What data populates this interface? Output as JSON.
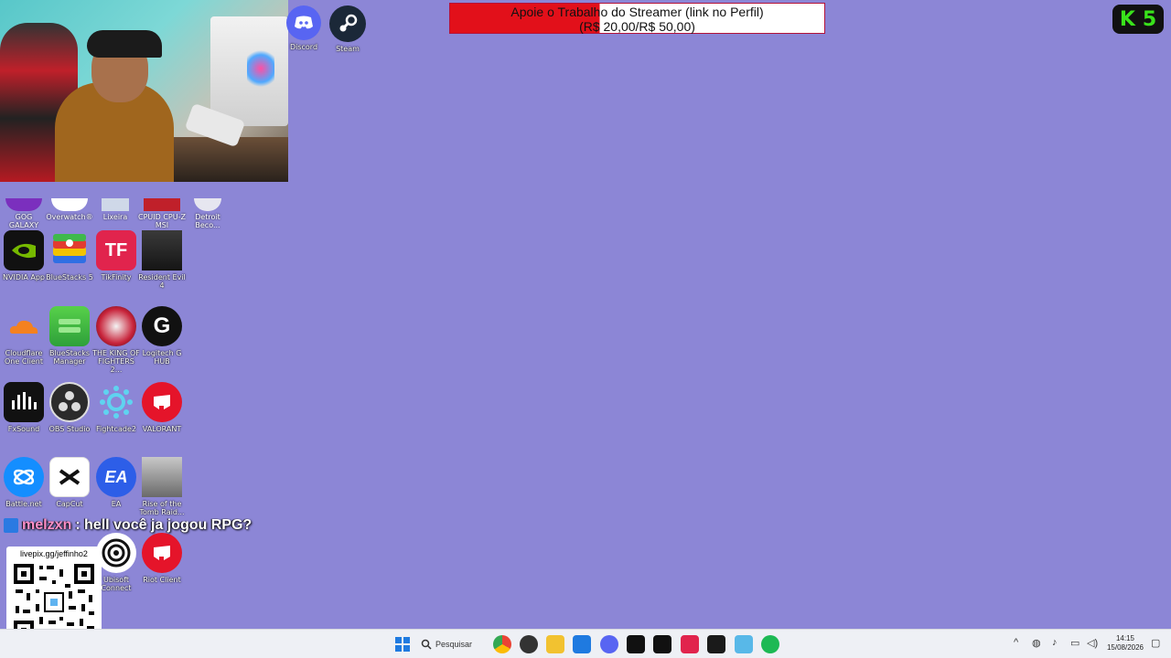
{
  "banner": {
    "line1": "Apoie o Trabalho do Streamer (link no Perfil)",
    "line2": "(R$ 20,00/R$ 50,00)",
    "progress_fraction": 0.4
  },
  "logo": {
    "k": "K",
    "five": "5"
  },
  "top_icons": [
    {
      "label": "Discord",
      "icon": "discord-icon",
      "color": "#5865f2"
    },
    {
      "label": "Steam",
      "icon": "steam-icon",
      "color": "#1b2838"
    }
  ],
  "desktop_icons": [
    {
      "label": "GOG GALAXY",
      "icon": "gog-galaxy-icon"
    },
    {
      "label": "Overwatch®",
      "icon": "overwatch-icon"
    },
    {
      "label": "Lixeira",
      "icon": "recycle-bin-icon"
    },
    {
      "label": "CPUID CPU-Z MSI",
      "icon": "cpuz-icon"
    },
    {
      "label": "Detroit Beco...",
      "icon": "detroit-icon"
    },
    {
      "label": "NVIDIA App",
      "icon": "nvidia-icon",
      "color": "#111"
    },
    {
      "label": "BlueStacks 5",
      "icon": "bluestacks-icon",
      "color": "#3fb94b"
    },
    {
      "label": "TikFinity",
      "icon": "tikfinity-icon",
      "color": "#e1244d"
    },
    {
      "label": "Resident Evil 4",
      "icon": "resident-evil-icon",
      "color": "#2a2a2a"
    },
    {
      "label": "Cloudflare One Client",
      "icon": "cloudflare-icon",
      "color": "#f48120"
    },
    {
      "label": "BlueStacks Manager",
      "icon": "bluestacks-manager-icon",
      "color": "#3fb94b"
    },
    {
      "label": "THE KING OF FIGHTERS 2...",
      "icon": "kof-icon",
      "color": "#c8233a"
    },
    {
      "label": "Logitech G HUB",
      "icon": "logitech-g-icon",
      "color": "#111"
    },
    {
      "label": "FxSound",
      "icon": "fxsound-icon",
      "color": "#111"
    },
    {
      "label": "OBS Studio",
      "icon": "obs-icon",
      "color": "#2b2b2b"
    },
    {
      "label": "Fightcade2",
      "icon": "fightcade-icon",
      "color": "#c9f0ff"
    },
    {
      "label": "VALORANT",
      "icon": "valorant-icon",
      "color": "#e5142a"
    },
    {
      "label": "Battle.net",
      "icon": "battlenet-icon",
      "color": "#148eff"
    },
    {
      "label": "CapCut",
      "icon": "capcut-icon",
      "color": "#ffffff"
    },
    {
      "label": "EA",
      "icon": "ea-icon",
      "color": "#2d5ee8"
    },
    {
      "label": "Rise of the Tomb Raid...",
      "icon": "tomb-raider-icon",
      "color": "#8a8a8a"
    },
    {
      "label": "Ubisoft Connect",
      "icon": "ubisoft-icon",
      "color": "#ffffff"
    },
    {
      "label": "Riot Client",
      "icon": "riot-client-icon",
      "color": "#e5142a"
    }
  ],
  "chat": {
    "user": "melzxn",
    "message": ": hell você ja jogou RPG?"
  },
  "qr": {
    "url": "livepix.gg/jeffinho2"
  },
  "taskbar": {
    "search_label": "Pesquisar",
    "time": "14:15",
    "date": "15/08/2026",
    "items": [
      {
        "icon": "windows-start-icon"
      },
      {
        "icon": "chrome-icon"
      },
      {
        "icon": "obs-taskbar-icon"
      },
      {
        "icon": "file-explorer-icon"
      },
      {
        "icon": "microsoft-store-icon"
      },
      {
        "icon": "discord-taskbar-icon"
      },
      {
        "icon": "piano-icon"
      },
      {
        "icon": "fxsound-taskbar-icon"
      },
      {
        "icon": "tikfinity-taskbar-icon"
      },
      {
        "icon": "capcut-taskbar-icon"
      },
      {
        "icon": "notepad-icon"
      },
      {
        "icon": "spotify-icon"
      }
    ]
  }
}
